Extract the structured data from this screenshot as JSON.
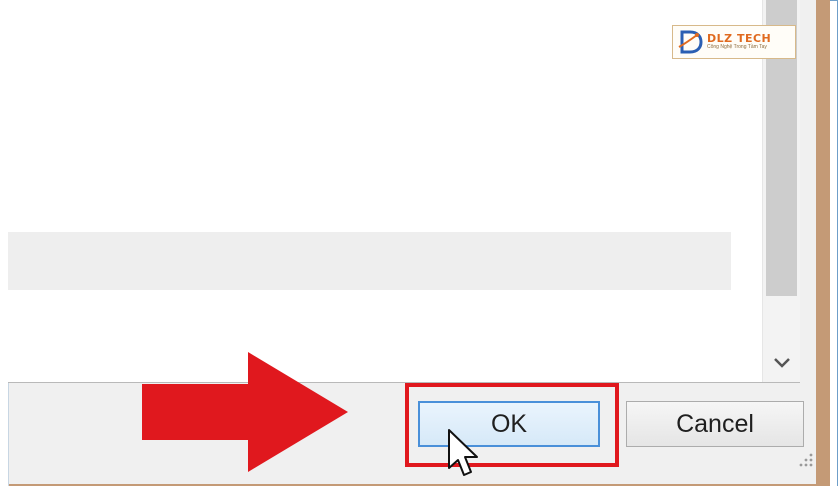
{
  "dialog": {
    "buttons": {
      "ok_label": "OK",
      "cancel_label": "Cancel"
    },
    "scrollbar": {
      "down_icon": "chevron-down-icon"
    }
  },
  "watermark": {
    "title": "DLZ TECH",
    "subtitle": "Công Nghệ Trong Tầm Tay"
  },
  "annotation": {
    "arrow_color": "#e0181e",
    "highlight_color": "#e0181e"
  },
  "colors": {
    "frame_border": "#c49a76",
    "ok_focus": "#4a90d9"
  }
}
